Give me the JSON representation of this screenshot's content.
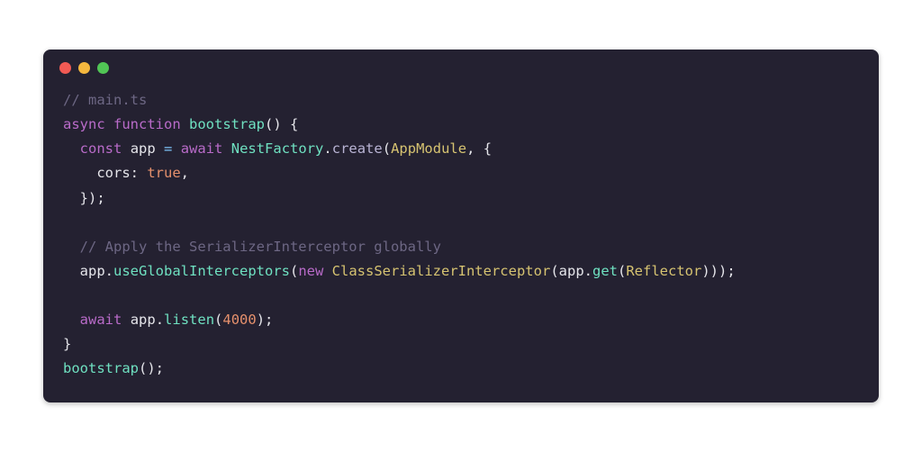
{
  "traffic_colors": {
    "red": "#f15a54",
    "yellow": "#f4b73e",
    "green": "#51c555"
  },
  "code": {
    "l1_comment": "// main.ts",
    "l2_async": "async",
    "l2_function": "function",
    "l2_boot": "bootstrap",
    "l2_tail": "() {",
    "l3_const": "const",
    "l3_app": "app",
    "l3_eq": "=",
    "l3_await": "await",
    "l3_nest": "NestFactory",
    "l3_dot": ".",
    "l3_create": "create",
    "l3_open": "(",
    "l3_appmod": "AppModule",
    "l3_tail": ", {",
    "l4_cors": "cors",
    "l4_colon": ":",
    "l4_true": "true",
    "l4_comma": ",",
    "l5_close": "});",
    "l7_comment": "// Apply the SerializerInterceptor globally",
    "l8_app": "app",
    "l8_dot1": ".",
    "l8_use": "useGlobalInterceptors",
    "l8_open": "(",
    "l8_new": "new",
    "l8_csi": "ClassSerializerInterceptor",
    "l8_open2": "(",
    "l8_app2": "app",
    "l8_dot2": ".",
    "l8_get": "get",
    "l8_open3": "(",
    "l8_refl": "Reflector",
    "l8_close": ")));",
    "l10_await": "await",
    "l10_app": "app",
    "l10_dot": ".",
    "l10_listen": "listen",
    "l10_open": "(",
    "l10_port": "4000",
    "l10_close": ");",
    "l11_brace": "}",
    "l12_boot": "bootstrap",
    "l12_tail": "();"
  }
}
